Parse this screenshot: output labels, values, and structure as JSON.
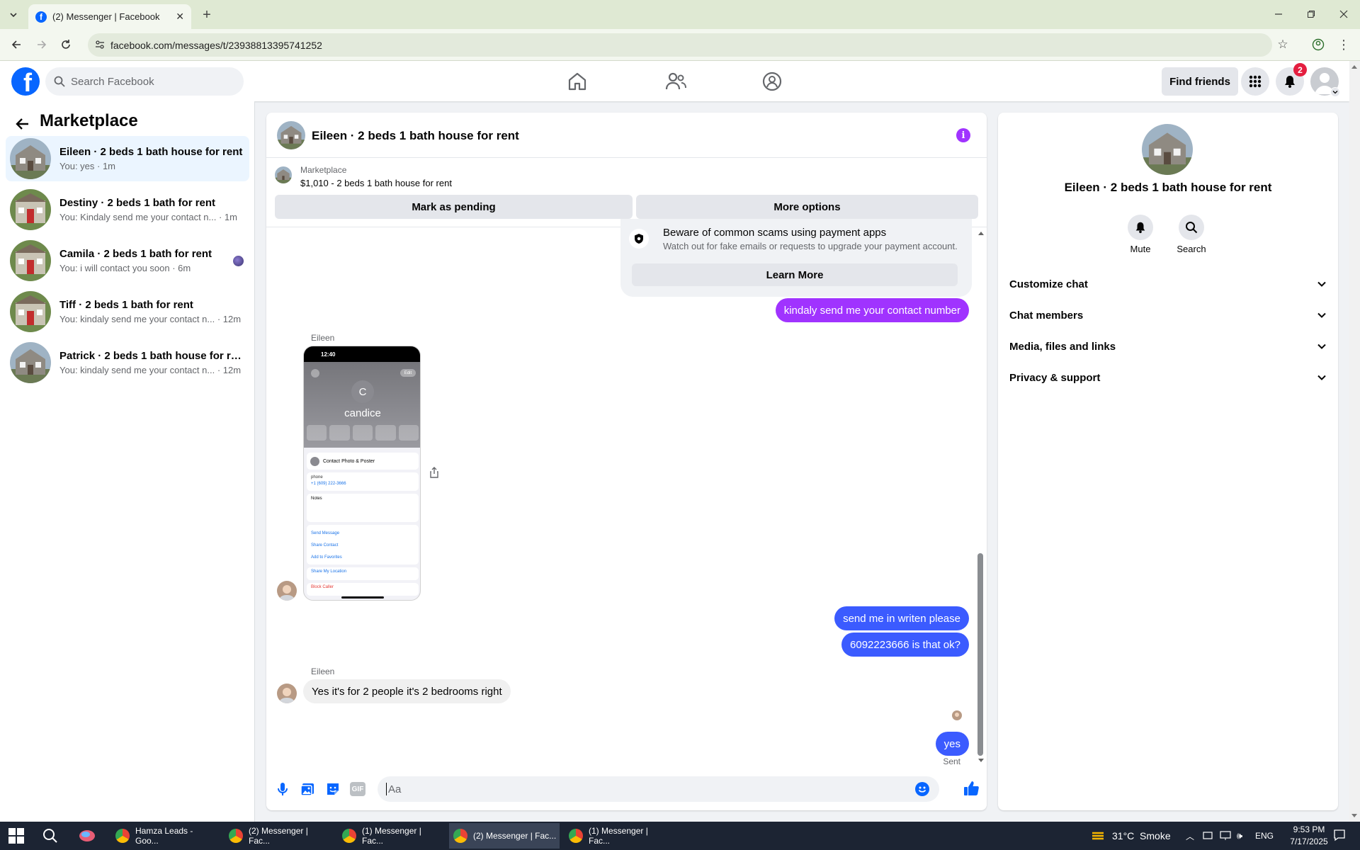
{
  "browser": {
    "tab_title": "(2) Messenger | Facebook",
    "url": "facebook.com/messages/t/23938813395741252"
  },
  "header": {
    "search_placeholder": "Search Facebook",
    "find_friends": "Find friends",
    "notification_count": "2"
  },
  "sidebar": {
    "title": "Marketplace",
    "conversations": [
      {
        "title": "Eileen · 2 beds 1 bath house for rent",
        "snippet": "You: yes · 1m"
      },
      {
        "title": "Destiny · 2 beds 1 bath for rent",
        "snippet": "You: Kindaly send me your contact n...",
        "time": " · 1m"
      },
      {
        "title": "Camila · 2 beds 1 bath for rent",
        "snippet": "You: i will contact you soon · 6m"
      },
      {
        "title": "Tiff · 2 beds 1 bath for rent",
        "snippet": "You: kindaly send me your contact n...",
        "time": " · 12m"
      },
      {
        "title": "Patrick · 2 beds 1 bath house for re...",
        "snippet": "You: kindaly send me your contact n...",
        "time": " · 12m"
      }
    ]
  },
  "chat": {
    "title": "Eileen · 2 beds 1 bath house for rent",
    "listing_label": "Marketplace",
    "listing_detail": "$1,010 - 2 beds 1 bath house for rent",
    "mark_pending": "Mark as pending",
    "more_options": "More options",
    "scam_title": "Beware of common scams using payment apps",
    "scam_text": "Watch out for fake emails or requests to upgrade your payment account.",
    "learn_more": "Learn More",
    "msg_contact": "kindaly send me your contact number",
    "sender_name": "Eileen",
    "screenshot": {
      "time": "12:40",
      "initial": "C",
      "name": "candice",
      "edit": "Edit",
      "contact_poster": "Contact Photo & Poster",
      "phone_label": "phone",
      "phone_number": "+1 (609) 222-3666",
      "notes": "Notes",
      "send_message": "Send Message",
      "share_contact": "Share Contact",
      "add_favorites": "Add to Favorites",
      "share_location": "Share My Location",
      "block_caller": "Block Caller"
    },
    "msg_writen": "send me in writen please",
    "msg_number": "6092223666 is that ok?",
    "sender_name_2": "Eileen",
    "msg_reply": "Yes it's for 2 people it's 2 bedrooms right",
    "msg_yes": "yes",
    "sent_label": "Sent",
    "composer_placeholder": "Aa"
  },
  "details": {
    "name": "Eileen · 2 beds 1 bath house for rent",
    "mute": "Mute",
    "search": "Search",
    "sections": [
      "Customize chat",
      "Chat members",
      "Media, files and links",
      "Privacy & support"
    ]
  },
  "taskbar": {
    "items": [
      "Hamza Leads - Goo...",
      "(2) Messenger | Fac...",
      "(1) Messenger | Fac...",
      "(2) Messenger | Fac...",
      "(1) Messenger | Fac..."
    ],
    "weather": "31°C  Smoke",
    "lang": "ENG",
    "time": "9:53 PM",
    "date": "7/17/2025"
  },
  "colors": {
    "fb_blue": "#0866ff",
    "purple": "#a033ff",
    "blue_bubble": "#3b5bff"
  }
}
